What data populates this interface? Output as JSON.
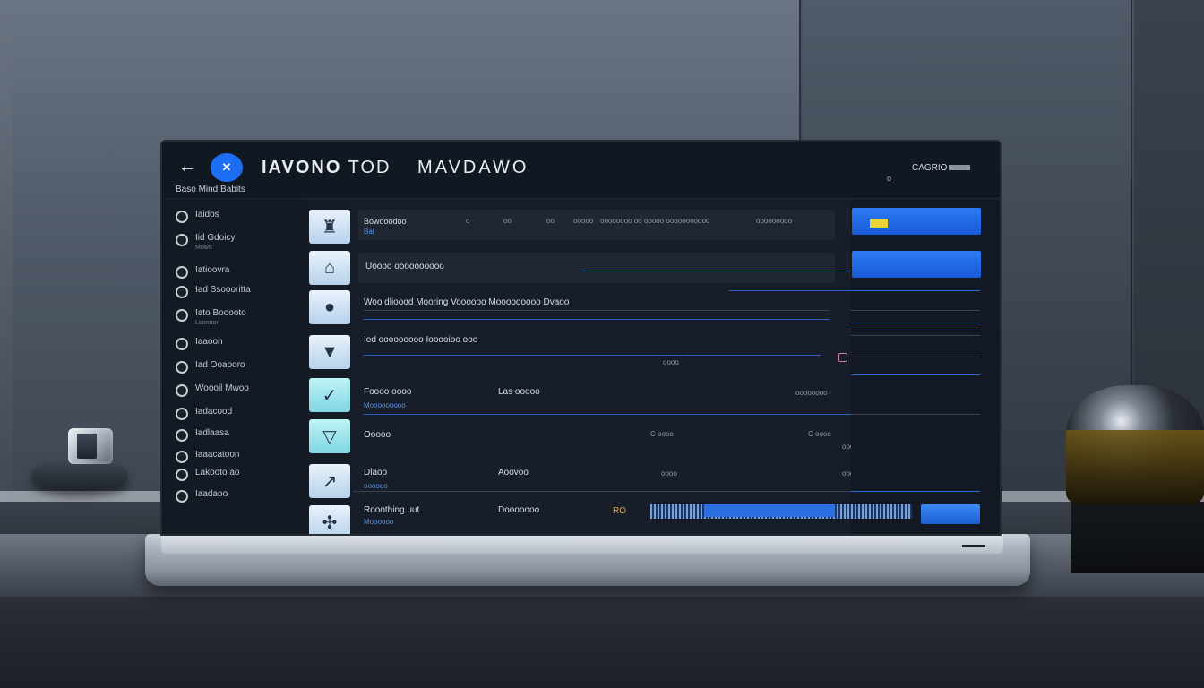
{
  "header": {
    "back_icon": "arrow-left-icon",
    "logo_glyph": "✕",
    "title_bold": "IAVONO",
    "title_mid": "TOD",
    "title_right": "MAVDAWO",
    "subtitle": "Baso Mind Babits",
    "user_label": "CAGRIO",
    "status_text": "o"
  },
  "sidebar": {
    "items": [
      {
        "label": "Iaidos",
        "sub": ""
      },
      {
        "label": "Iid Gdoicy",
        "sub": "Mowo"
      },
      {
        "label": "Iatioovra",
        "sub": ""
      },
      {
        "label": "Iad Ssoooritta",
        "sub": ""
      },
      {
        "label": "Iato Booooto",
        "sub": "Loonoon"
      },
      {
        "label": "Iaaoon",
        "sub": ""
      },
      {
        "label": "Iad Ooaooro",
        "sub": ""
      },
      {
        "label": "Woooil Mwoo",
        "sub": ""
      },
      {
        "label": "Iadacood",
        "sub": ""
      },
      {
        "label": "Iadlaasa",
        "sub": ""
      },
      {
        "label": "Iaaacatoon",
        "sub": ""
      },
      {
        "label": "Lakooto ao",
        "sub": ""
      },
      {
        "label": "Iaadaoo",
        "sub": ""
      }
    ]
  },
  "thumbnails": [
    {
      "icon": "lamp-icon",
      "glyph": "♜"
    },
    {
      "icon": "router-icon",
      "glyph": "⌂"
    },
    {
      "icon": "speaker-icon",
      "glyph": "●"
    },
    {
      "icon": "cup-icon",
      "glyph": "▼"
    },
    {
      "icon": "wand-icon",
      "glyph": "✓"
    },
    {
      "icon": "funnel-icon",
      "glyph": "▽"
    },
    {
      "icon": "arrow-icon",
      "glyph": "↗"
    },
    {
      "icon": "fan-icon",
      "glyph": "✣"
    }
  ],
  "rows": [
    {
      "title": "Bowooodoo",
      "col2": "o",
      "col3": "oo",
      "col4": "oo",
      "col5": "ooooo",
      "col6": "oooooooo oo ooooo ooooooooooo",
      "col7": "ooooooooo",
      "tag": "Bal"
    },
    {
      "title": "Uoooo oooooooooo",
      "col2": "",
      "col3": "",
      "col4": "",
      "col5": "",
      "col6": "",
      "col7": "",
      "tag": ""
    },
    {
      "title": "Woo dlioood Mooring Voooooo Mooooooooo Dvaoo",
      "col2": "",
      "col3": "",
      "col4": "",
      "col5": "",
      "col6": "",
      "col7": "",
      "tag": ""
    },
    {
      "title": "Iod ooooooooo Iooooioo ooo",
      "col2": "",
      "col3": "",
      "col4": "",
      "col5": "oooo",
      "col6": "",
      "col7": "",
      "tag": ""
    },
    {
      "title": "Foooo oooo",
      "col2": "Las ooooo",
      "col3": "",
      "col4": "",
      "col5": "",
      "col6": "oooooooo",
      "col7": "",
      "tag": "Mooooooooo"
    },
    {
      "title": "Ooooo",
      "col2": "",
      "col3": "C oooo",
      "col4": "",
      "col5": "",
      "col6": "C oooo",
      "col7": "oooooo",
      "tag": ""
    },
    {
      "title": "Dlaoo",
      "col2": "Aoovoo",
      "col3": "oooo",
      "col4": "",
      "col5": "",
      "col6": "oooooooooo",
      "col7": "",
      "tag": "oooooo"
    },
    {
      "title": "Rooothing uut",
      "col2": "Dooooooo",
      "col3": "",
      "col4": "",
      "col5": "",
      "col6": "",
      "col7": "",
      "tag": "Moooooo"
    }
  ],
  "wave_badge": "RO",
  "colors": {
    "accent": "#1d6ef2",
    "panel_bg": "#151b25",
    "highlight": "#e8d437"
  }
}
